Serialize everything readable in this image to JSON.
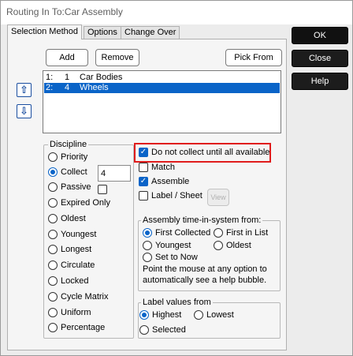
{
  "window": {
    "title": "Routing In To:Car Assembly"
  },
  "tabs": [
    {
      "label": "Selection Method",
      "active": true
    },
    {
      "label": "Options",
      "active": false
    },
    {
      "label": "Change Over",
      "active": false
    }
  ],
  "side_buttons": {
    "ok": "OK",
    "close": "Close",
    "help": "Help"
  },
  "toolbar": {
    "add": "Add",
    "remove": "Remove",
    "pick_from": "Pick From"
  },
  "move_icons": {
    "up": "move-up-icon",
    "down": "move-down-icon"
  },
  "routing_list": [
    {
      "index": "1:",
      "quantity": "1",
      "name": "Car Bodies",
      "selected": false
    },
    {
      "index": "2:",
      "quantity": "4",
      "name": "Wheels",
      "selected": true
    }
  ],
  "discipline": {
    "label": "Discipline",
    "selected": "Collect",
    "options": [
      "Priority",
      "Collect",
      "Passive",
      "Expired Only",
      "Oldest",
      "Youngest",
      "Longest",
      "Circulate",
      "Locked",
      "Cycle Matrix",
      "Uniform",
      "Percentage"
    ],
    "collect_value": "4",
    "passive_checked": false
  },
  "flags": {
    "do_not_collect": {
      "label": "Do not collect until all available",
      "checked": true
    },
    "match": {
      "label": "Match",
      "checked": false
    },
    "assemble": {
      "label": "Assemble",
      "checked": true
    },
    "label_sheet": {
      "label": "Label / Sheet",
      "checked": false
    },
    "view_button": "View"
  },
  "assembly_time": {
    "label": "Assembly time-in-system from:",
    "options": [
      "First Collected",
      "First in List",
      "Youngest",
      "Oldest",
      "Set to Now"
    ],
    "selected": "First Collected",
    "help_line1": "Point the mouse at any option to",
    "help_line2": "automatically see a help bubble."
  },
  "label_values": {
    "label": "Label values from",
    "options": [
      "Highest",
      "Lowest",
      "Selected"
    ],
    "selected": "Highest"
  },
  "colors": {
    "accent": "#0a64c8",
    "highlight": "#e01c1c",
    "button_dark": "#1c1c1c"
  }
}
